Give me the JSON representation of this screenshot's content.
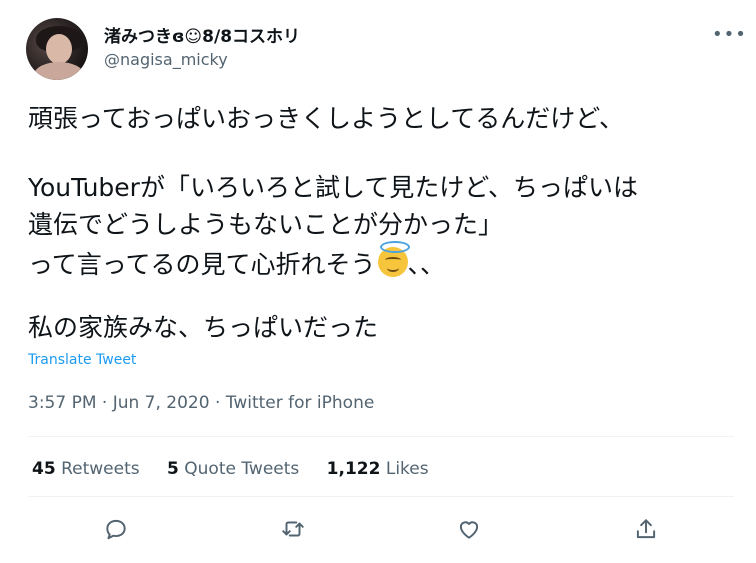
{
  "author": {
    "display_name": "渚みつきɞ☺︎8/8コスホリ",
    "handle": "@nagisa_micky"
  },
  "more_label": "•••",
  "body": {
    "line1": "頑張っておっぱいおっきくしようとしてるんだけど、",
    "line2": "YouTuberが「いろいろと試して見たけど、ちっぱいは",
    "line3": "遺伝でどうしようもないことが分かった」",
    "line4_before": "って言ってるの見て心折れそう",
    "line4_after": "、、",
    "line5": "私の家族みな、ちっぱいだった"
  },
  "translate_label": "Translate Tweet",
  "meta": "3:57 PM · Jun 7, 2020 · Twitter for iPhone",
  "stats": {
    "retweets_count": "45",
    "retweets_label": "Retweets",
    "quotes_count": "5",
    "quotes_label": "Quote Tweets",
    "likes_count": "1,122",
    "likes_label": "Likes"
  },
  "icons": [
    "reply-icon",
    "retweet-icon",
    "like-icon",
    "share-icon",
    "smiling-face-with-halo-emoji"
  ],
  "colors": {
    "link": "#1d9bf0",
    "secondary_text": "#536471",
    "divider": "#eff3f4"
  }
}
